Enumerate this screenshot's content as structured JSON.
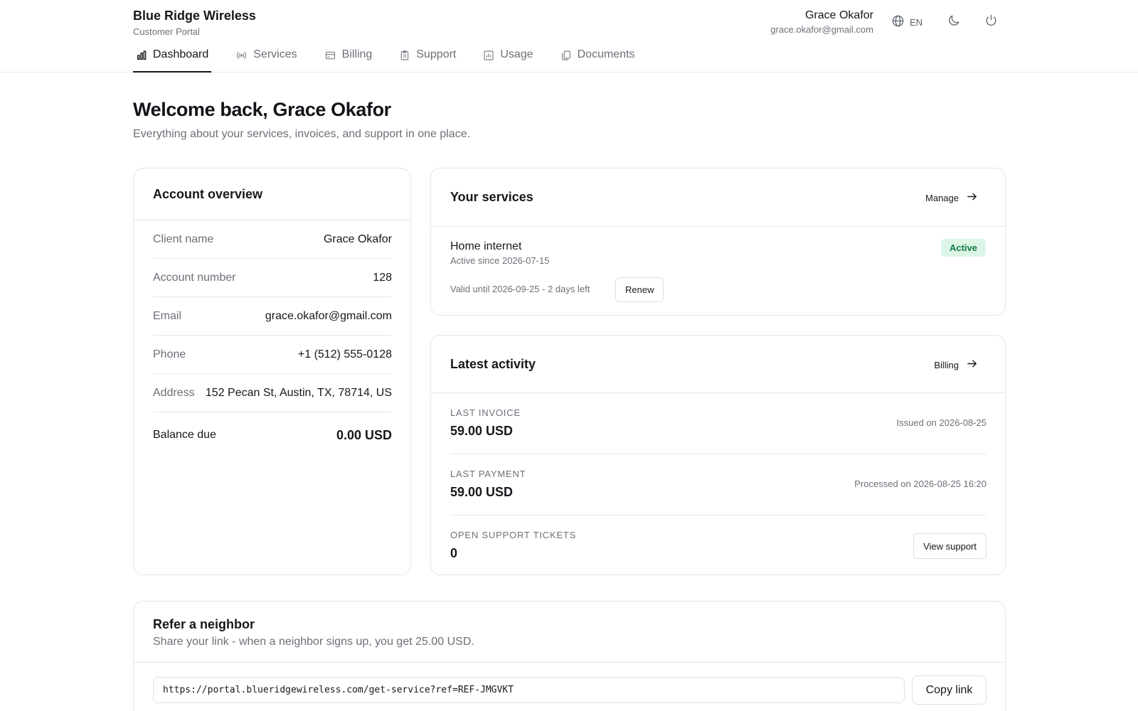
{
  "brand": {
    "title": "Blue Ridge Wireless",
    "subtitle": "Customer Portal"
  },
  "user": {
    "name": "Grace Okafor",
    "email": "grace.okafor@gmail.com"
  },
  "language": {
    "code": "EN",
    "icon": "globe-icon"
  },
  "header_icons": {
    "theme": "moon-icon",
    "logout": "power-icon"
  },
  "tabs": [
    {
      "label": "Dashboard",
      "icon": "bar-chart-icon",
      "active": true
    },
    {
      "label": "Services",
      "icon": "broadcast-icon",
      "active": false
    },
    {
      "label": "Billing",
      "icon": "credit-card-icon",
      "active": false
    },
    {
      "label": "Support",
      "icon": "clipboard-icon",
      "active": false
    },
    {
      "label": "Usage",
      "icon": "chart-icon",
      "active": false
    },
    {
      "label": "Documents",
      "icon": "documents-icon",
      "active": false
    }
  ],
  "welcome": {
    "title": "Welcome back, Grace Okafor",
    "subtitle": "Everything about your services, invoices, and support in one place."
  },
  "account": {
    "title": "Account overview",
    "rows": [
      {
        "label": "Client name",
        "value": "Grace Okafor"
      },
      {
        "label": "Account number",
        "value": "128"
      },
      {
        "label": "Email",
        "value": "grace.okafor@gmail.com"
      },
      {
        "label": "Phone",
        "value": "+1 (512) 555-0128"
      },
      {
        "label": "Address",
        "value": "152 Pecan St, Austin, TX, 78714, US"
      }
    ],
    "balance_label": "Balance due",
    "balance_value": "0.00 USD"
  },
  "services": {
    "title": "Your services",
    "manage_label": "Manage",
    "item": {
      "name": "Home internet",
      "since": "Active since 2026-07-15",
      "status": "Active",
      "valid": "Valid until 2026-09-25 - 2 days left",
      "renew_label": "Renew"
    }
  },
  "activity": {
    "title": "Latest activity",
    "billing_label": "Billing",
    "last_invoice": {
      "label": "LAST INVOICE",
      "value": "59.00 USD",
      "meta": "Issued on 2026-08-25"
    },
    "last_payment": {
      "label": "LAST PAYMENT",
      "value": "59.00 USD",
      "meta": "Processed on 2026-08-25 16:20"
    },
    "open_tickets": {
      "label": "OPEN SUPPORT TICKETS",
      "value": "0",
      "button_label": "View support"
    }
  },
  "referral": {
    "title": "Refer a neighbor",
    "subtitle": "Share your link - when a neighbor signs up, you get 25.00 USD.",
    "link": "https://portal.blueridgewireless.com/get-service?ref=REF-JMGVKT",
    "copy_label": "Copy link"
  },
  "colors": {
    "text": "#16181c",
    "muted": "#6b7078",
    "border": "#e3e5e8",
    "success_bg": "#dcf5e7",
    "success_text": "#127a45"
  }
}
